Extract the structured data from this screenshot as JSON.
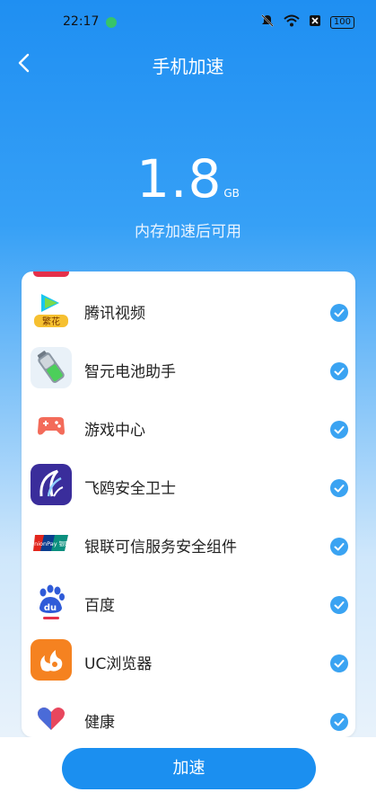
{
  "status": {
    "time": "22:17",
    "battery": "100"
  },
  "header": {
    "title": "手机加速"
  },
  "summary": {
    "value": "1.8",
    "unit": "GB",
    "caption": "内存加速后可用"
  },
  "apps": [
    {
      "name": "腾讯视频",
      "icon": "tencent-video-icon",
      "icon_badge": "繁花",
      "checked": true
    },
    {
      "name": "智元电池助手",
      "icon": "battery-assistant-icon",
      "checked": true
    },
    {
      "name": "游戏中心",
      "icon": "game-center-icon",
      "checked": true
    },
    {
      "name": "飞鸥安全卫士",
      "icon": "feiou-security-icon",
      "checked": true
    },
    {
      "name": "银联可信服务安全组件",
      "icon": "unionpay-icon",
      "icon_text": "UnionPay 银联",
      "checked": true
    },
    {
      "name": "百度",
      "icon": "baidu-icon",
      "icon_text": "du",
      "checked": true
    },
    {
      "name": "UC浏览器",
      "icon": "uc-browser-icon",
      "checked": true
    },
    {
      "name": "健康",
      "icon": "health-icon",
      "checked": true
    }
  ],
  "action": {
    "label": "加速"
  },
  "colors": {
    "primary": "#1b8ff0",
    "check": "#3aa3f2"
  }
}
